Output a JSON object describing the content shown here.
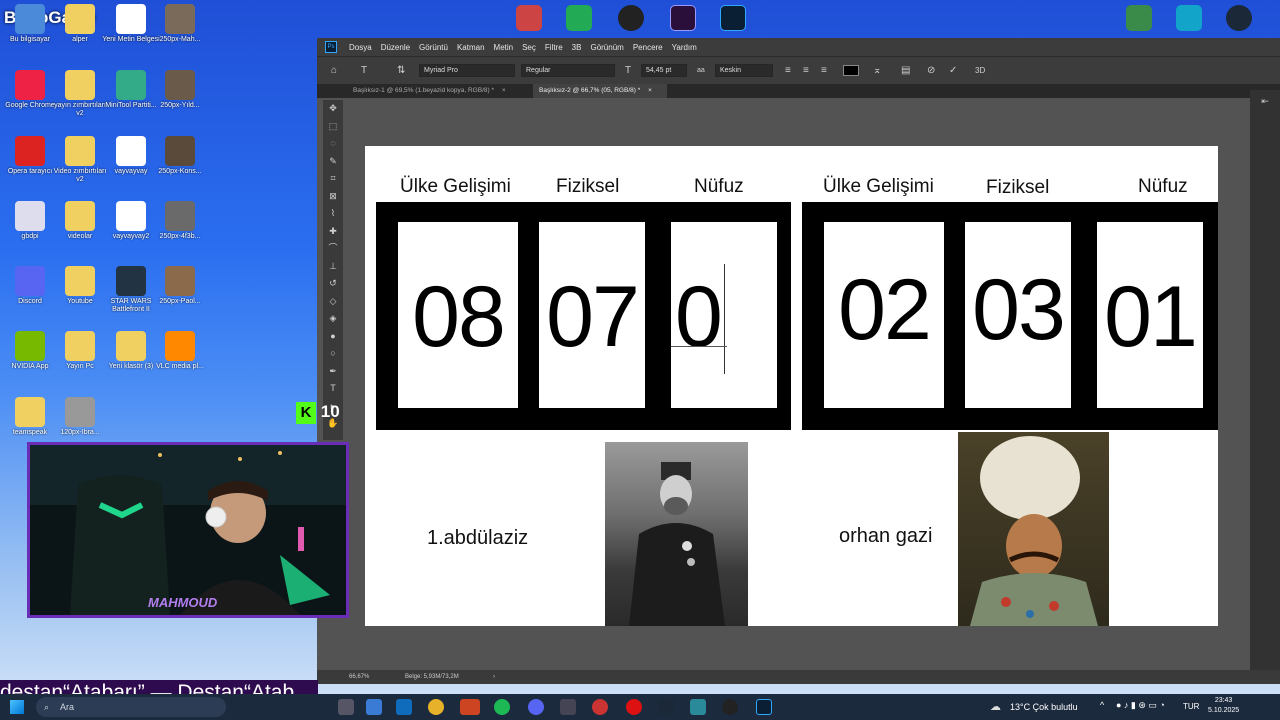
{
  "desktop": {
    "brand": "ByNoGame",
    "icons": [
      {
        "label": "Bu bilgisayar"
      },
      {
        "label": "alper"
      },
      {
        "label": "Yeni Metin Belgesi"
      },
      {
        "label": "250px-Mah..."
      },
      {
        "label": "Google Chrome"
      },
      {
        "label": "yayın zımbırtıları v2"
      },
      {
        "label": "MiniTool Partiti..."
      },
      {
        "label": "250px-Yıld..."
      },
      {
        "label": "Opera tarayıcı"
      },
      {
        "label": "Video zımbırtıları v2"
      },
      {
        "label": "vayvayvay"
      },
      {
        "label": "250px-Kons..."
      },
      {
        "label": "gbdpi"
      },
      {
        "label": "videolar"
      },
      {
        "label": "vayvayvay2"
      },
      {
        "label": "250px-4f3b..."
      },
      {
        "label": "Discord"
      },
      {
        "label": "Youtube"
      },
      {
        "label": "STAR WARS Battlefront II"
      },
      {
        "label": "250px-Paol..."
      },
      {
        "label": "NVIDIA App"
      },
      {
        "label": "Yayın Pc"
      },
      {
        "label": "Yeni klasör (3)"
      },
      {
        "label": "VLC media pl..."
      },
      {
        "label": "teamspeak"
      },
      {
        "label": "120px-Ibra..."
      }
    ],
    "overlay_badge": "10"
  },
  "photoshop": {
    "menu": [
      "Dosya",
      "Düzenle",
      "Görüntü",
      "Katman",
      "Metin",
      "Seç",
      "Filtre",
      "3B",
      "Görünüm",
      "Pencere",
      "Yardım"
    ],
    "options": {
      "font_family": "Myriad Pro",
      "font_style": "Regular",
      "font_size": "54,45 pt",
      "antialias": "Keskin",
      "label_3d": "3D"
    },
    "tabs": [
      {
        "label": "Başlıksız-1 @ 69,5% (1.beyazid kopya, RGB/8) *"
      },
      {
        "label": "Başlıksız-2 @ 66,7% (05, RGB/8) *"
      }
    ],
    "status": {
      "zoom": "66,67%",
      "doc": "Belge: 5,93M/73,2M"
    }
  },
  "canvas": {
    "left": {
      "headers": [
        "Ülke Gelişimi",
        "Fiziksel",
        "Nüfuz"
      ],
      "values": [
        "08",
        "07",
        "0"
      ],
      "caption": "1.abdülaziz"
    },
    "right": {
      "headers": [
        "Ülke Gelişimi",
        "Fiziksel",
        "Nüfuz"
      ],
      "values": [
        "02",
        "03",
        "01"
      ],
      "caption": "orhan gazi"
    }
  },
  "stream": {
    "banner": "destan“Atabarı” — Destan“Atab",
    "cam_watermark": "MAHMOUD"
  },
  "taskbar": {
    "search_placeholder": "Ara",
    "weather": "13°C  Çok bulutlu",
    "lang": "TUR",
    "time": "23:43",
    "date": "5.10.2025"
  },
  "colors": {
    "accent": "#31a8ff",
    "banner": "#2e0b4f",
    "cam_border": "#6a2db8"
  }
}
